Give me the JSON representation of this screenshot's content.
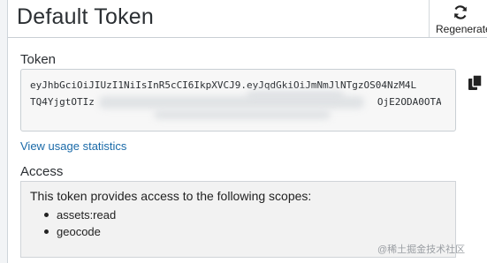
{
  "header": {
    "title": "Default Token",
    "regenerate_label": "Regenerate"
  },
  "token": {
    "label": "Token",
    "line1": "eyJhbGciOiJIUzI1NiIsInR5cCI6IkpXVCJ9.eyJqdGkiOiJmNmJlNTgzOS04NzM4L",
    "line2": "TQ4YjgtOTIz",
    "line2_end": "OjE2ODA0OTA"
  },
  "links": {
    "usage": "View usage statistics"
  },
  "access": {
    "label": "Access",
    "description": "This token provides access to the following scopes:",
    "scopes": [
      "assets:read",
      "geocode"
    ]
  },
  "watermark": "@稀土掘金技术社区",
  "icons": {
    "regenerate": "refresh-icon",
    "copy": "copy-icon"
  }
}
